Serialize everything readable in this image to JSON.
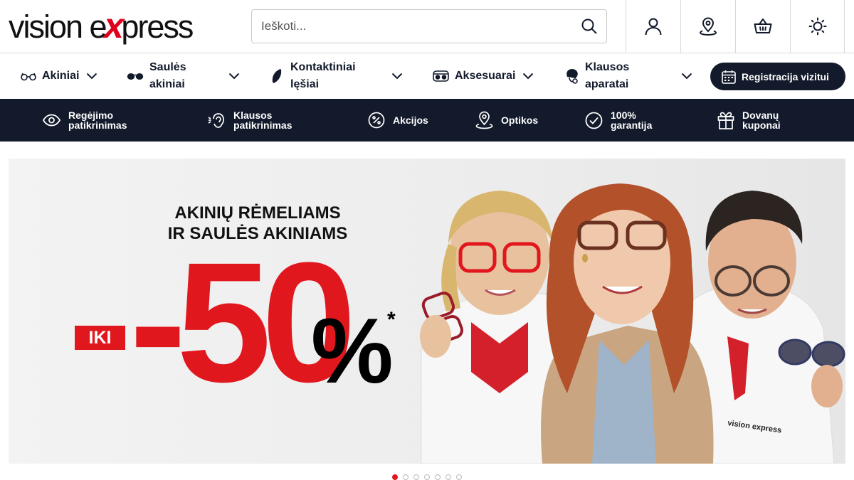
{
  "header": {
    "logo": {
      "text_left": "vision e",
      "text_x": "x",
      "text_right": "press"
    },
    "search": {
      "placeholder": "Ieškoti...",
      "value": ""
    },
    "buttons": [
      "account",
      "store-locator",
      "basket",
      "theme-toggle"
    ]
  },
  "nav": {
    "items": [
      {
        "label": "Akiniai",
        "icon": "glasses-icon"
      },
      {
        "label": "Saulės akiniai",
        "icon": "sunglasses-icon"
      },
      {
        "label": "Kontaktiniai lęšiai",
        "icon": "contact-lens-icon"
      },
      {
        "label": "Aksesuarai",
        "icon": "glasses-case-icon"
      },
      {
        "label": "Klausos aparatai",
        "icon": "hearing-aid-icon"
      }
    ],
    "cta": "Registracija vizitui"
  },
  "services": {
    "items": [
      {
        "label": "Regėjimo patikrinimas",
        "icon": "eye-icon"
      },
      {
        "label": "Klausos patikrinimas",
        "icon": "ear-icon"
      },
      {
        "label": "Akcijos",
        "icon": "percent-icon"
      },
      {
        "label": "Optikos",
        "icon": "location-pin-icon"
      },
      {
        "label": "100% garantija",
        "icon": "check-circle-icon"
      },
      {
        "label": "Dovanų kuponai",
        "icon": "gift-icon"
      }
    ]
  },
  "banner": {
    "headline_line1": "AKINIŲ RĖMELIAMS",
    "headline_line2": "IR SAULĖS AKINIAMS",
    "prefix": "IKI",
    "discount": "-50",
    "percent": "%",
    "asterisk": "*",
    "shirt_logo": "vision express"
  },
  "carousel": {
    "slides": 7,
    "active_index": 0
  },
  "colors": {
    "brand_red": "#e1171e",
    "navy": "#121a2b"
  }
}
